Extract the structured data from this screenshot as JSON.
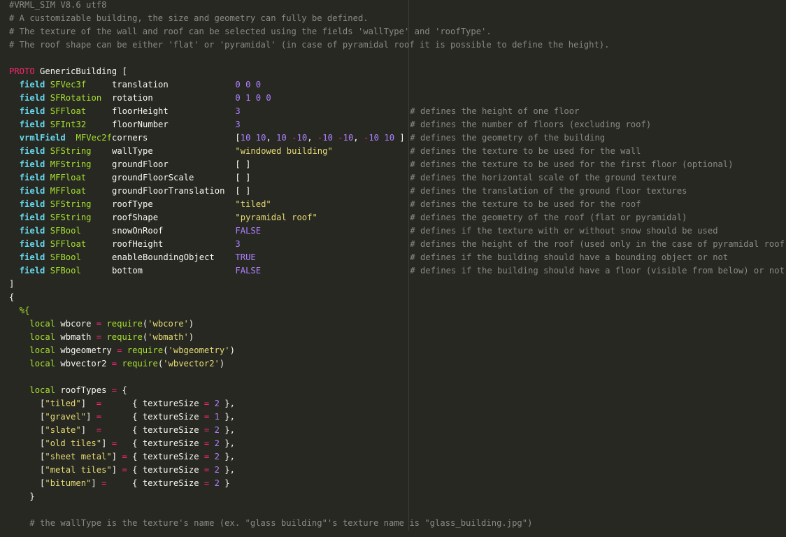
{
  "editor": {
    "header": [
      "#VRML_SIM V8.6 utf8",
      "# A customizable building, the size and geometry can fully be defined.",
      "# The texture of the wall and roof can be selected using the fields 'wallType' and 'roofType'.",
      "# The roof shape can be either 'flat' or 'pyramidal' (in case of pyramidal roof it is possible to define the height)."
    ],
    "proto_keyword": "PROTO",
    "proto_name": "GenericBuilding [",
    "fields": [
      {
        "kind": "field",
        "type": "SFVec3f",
        "name": "translation",
        "value": "0 0 0",
        "value_style": "number",
        "comment": ""
      },
      {
        "kind": "field",
        "type": "SFRotation",
        "name": "rotation",
        "value": "0 1 0 0",
        "value_style": "number",
        "comment": ""
      },
      {
        "kind": "field",
        "type": "SFFloat",
        "name": "floorHeight",
        "value": "3",
        "value_style": "number",
        "comment": "# defines the height of one floor"
      },
      {
        "kind": "field",
        "type": "SFInt32",
        "name": "floorNumber",
        "value": "3",
        "value_style": "number",
        "comment": "# defines the number of floors (excluding roof)"
      },
      {
        "kind": "vrmlField",
        "type": "MFVec2f",
        "name": "corners",
        "value": "[10 10, 10 -10, -10 -10, -10 10 ]",
        "value_style": "array",
        "comment": "# defines the geometry of the building"
      },
      {
        "kind": "field",
        "type": "SFString",
        "name": "wallType",
        "value": "\"windowed building\"",
        "value_style": "string",
        "comment": "# defines the texture to be used for the wall"
      },
      {
        "kind": "field",
        "type": "MFString",
        "name": "groundFloor",
        "value": "[ ]",
        "value_style": "plain",
        "comment": "# defines the texture to be used for the first floor (optional)"
      },
      {
        "kind": "field",
        "type": "MFFloat",
        "name": "groundFloorScale",
        "value": "[ ]",
        "value_style": "plain",
        "comment": "# defines the horizontal scale of the ground texture"
      },
      {
        "kind": "field",
        "type": "MFFloat",
        "name": "groundFloorTranslation",
        "value": "[ ]",
        "value_style": "plain",
        "comment": "# defines the translation of the ground floor textures"
      },
      {
        "kind": "field",
        "type": "SFString",
        "name": "roofType",
        "value": "\"tiled\"",
        "value_style": "string",
        "comment": "# defines the texture to be used for the roof"
      },
      {
        "kind": "field",
        "type": "SFString",
        "name": "roofShape",
        "value": "\"pyramidal roof\"",
        "value_style": "string",
        "comment": "# defines the geometry of the roof (flat or pyramidal)"
      },
      {
        "kind": "field",
        "type": "SFBool",
        "name": "snowOnRoof",
        "value": "FALSE",
        "value_style": "number",
        "comment": "# defines if the texture with or without snow should be used"
      },
      {
        "kind": "field",
        "type": "SFFloat",
        "name": "roofHeight",
        "value": "3",
        "value_style": "number",
        "comment": "# defines the height of the roof (used only in the case of pyramidal roof)"
      },
      {
        "kind": "field",
        "type": "SFBool",
        "name": "enableBoundingObject",
        "value": "TRUE",
        "value_style": "number",
        "comment": "# defines if the building should have a bounding object or not"
      },
      {
        "kind": "field",
        "type": "SFBool",
        "name": "bottom",
        "value": "FALSE",
        "value_style": "number",
        "comment": "# defines if the building should have a floor (visible from below) or not"
      }
    ],
    "close_bracket": "]",
    "open_brace": "{",
    "template_open": "%{",
    "requires": [
      {
        "var": "wbcore",
        "module": "'wbcore'"
      },
      {
        "var": "wbmath",
        "module": "'wbmath'"
      },
      {
        "var": "wbgeometry",
        "module": "'wbgeometry'"
      },
      {
        "var": "wbvector2",
        "module": "'wbvector2'"
      }
    ],
    "local_keyword": "local",
    "require_keyword": "require",
    "roof_types_var": "roofTypes",
    "roof_types": [
      {
        "key": "\"tiled\"",
        "pad": "  =      ",
        "size": "2",
        "sep": " },"
      },
      {
        "key": "\"gravel\"",
        "pad": " =      ",
        "size": "1",
        "sep": " },"
      },
      {
        "key": "\"slate\"",
        "pad": "  =      ",
        "size": "2",
        "sep": " },"
      },
      {
        "key": "\"old tiles\"",
        "pad": " =   ",
        "size": "2",
        "sep": " },"
      },
      {
        "key": "\"sheet metal\"",
        "pad": " = ",
        "size": "2",
        "sep": " },"
      },
      {
        "key": "\"metal tiles\"",
        "pad": " = ",
        "size": "2",
        "sep": " },"
      },
      {
        "key": "\"bitumen\"",
        "pad": " =     ",
        "size": "2",
        "sep": " }"
      }
    ],
    "texture_size_label": "textureSize",
    "table_close": "}",
    "last_comment": "# the wallType is the texture's name (ex. \"glass building\"'s texture name is \"glass_building.jpg\")"
  }
}
